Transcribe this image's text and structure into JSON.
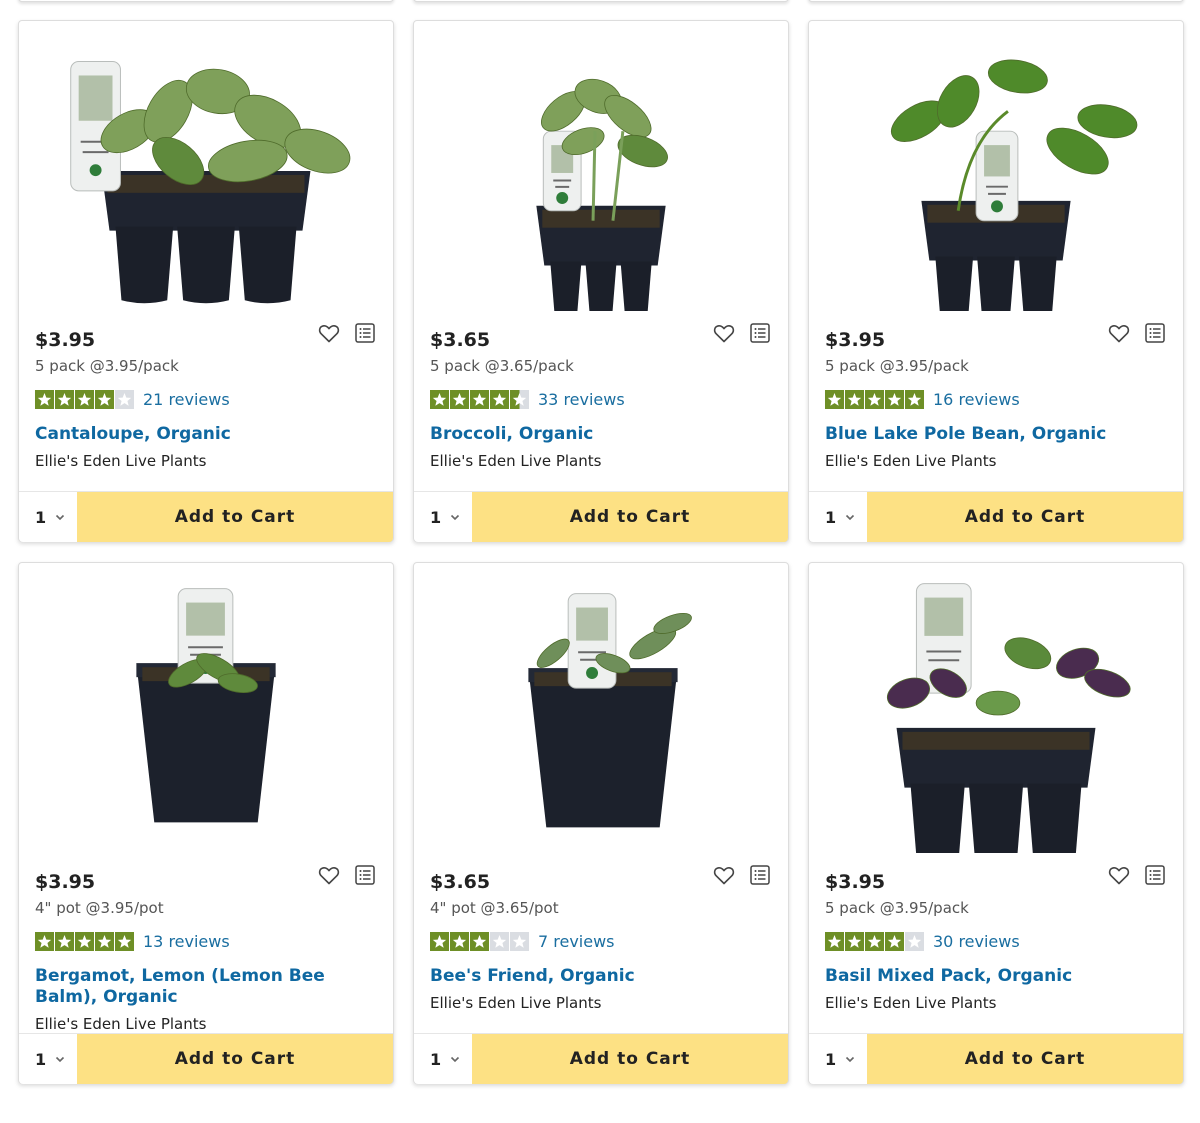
{
  "add_to_cart_label": "Add to Cart",
  "colors": {
    "star_fill": "#6e8f26",
    "star_empty": "#dadde2",
    "link": "#0f68a1",
    "button": "#fde184"
  },
  "products": [
    {
      "price": "$3.95",
      "unit": "5 pack @3.95/pack",
      "rating": 4,
      "reviews": "21 reviews",
      "title": "Cantaloupe, Organic",
      "brand": "Ellie's Eden Live Plants",
      "qty": "1",
      "image": "six-pack-cantaloupe"
    },
    {
      "price": "$3.65",
      "unit": "5 pack @3.65/pack",
      "rating": 4.5,
      "reviews": "33 reviews",
      "title": "Broccoli, Organic",
      "brand": "Ellie's Eden Live Plants",
      "qty": "1",
      "image": "six-pack-broccoli"
    },
    {
      "price": "$3.95",
      "unit": "5 pack @3.95/pack",
      "rating": 5,
      "reviews": "16 reviews",
      "title": "Blue Lake Pole Bean, Organic",
      "brand": "Ellie's Eden Live Plants",
      "qty": "1",
      "image": "six-pack-bean"
    },
    {
      "price": "$3.95",
      "unit": "4\" pot @3.95/pot",
      "rating": 5,
      "reviews": "13 reviews",
      "title": "Bergamot, Lemon (Lemon Bee Balm), Organic",
      "brand": "Ellie's Eden Live Plants",
      "qty": "1",
      "image": "pot-bee-balm"
    },
    {
      "price": "$3.65",
      "unit": "4\" pot @3.65/pot",
      "rating": 3,
      "reviews": "7 reviews",
      "title": "Bee's Friend, Organic",
      "brand": "Ellie's Eden Live Plants",
      "qty": "1",
      "image": "pot-bees-friend"
    },
    {
      "price": "$3.95",
      "unit": "5 pack @3.95/pack",
      "rating": 4,
      "reviews": "30 reviews",
      "title": "Basil Mixed Pack, Organic",
      "brand": "Ellie's Eden Live Plants",
      "qty": "1",
      "image": "six-pack-basil"
    }
  ]
}
